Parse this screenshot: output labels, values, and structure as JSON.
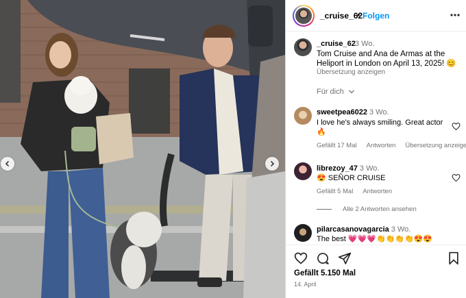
{
  "post": {
    "author": "_cruise_62",
    "follow_label": "Folgen",
    "separator": "•",
    "caption_user": "_cruise_62",
    "caption_time": "3 Wo.",
    "caption_text": "Tom Cruise and Ana de Armas at the Heliport in London on April 13, 2025! 😊",
    "translate_label": "Übersetzung anzeigen",
    "for_you_label": "Für dich",
    "likes": "Gefällt 5.150 Mal",
    "date": "14. April"
  },
  "comments": [
    {
      "user": "sweetpea6022",
      "time": "3 Wo.",
      "text": "I love he's always smiling. Great actor",
      "text2": "🔥",
      "likes": "Gefällt 17 Mal",
      "reply_label": "Antworten",
      "translate_label": "Übersetzung anzeigen"
    },
    {
      "user": "librezoy_47",
      "time": "3 Wo.",
      "text": "😍 SEÑOR CRUISE",
      "likes": "Gefällt 5 Mal",
      "reply_label": "Antworten",
      "view_replies": "Alle 2 Antworten ansehen"
    },
    {
      "user": "pilarcasanovagarcia",
      "time": "3 Wo.",
      "text": "The best 💗💗💗👏👏👏👏😍😍"
    }
  ],
  "colors": {
    "link_blue": "#0095f6",
    "muted_text": "#737373",
    "border": "#dbdbdb"
  },
  "icons": [
    "chevron-left-icon",
    "chevron-right-icon",
    "more-icon",
    "heart-icon",
    "comment-icon",
    "share-icon",
    "bookmark-icon",
    "chevron-down-icon"
  ]
}
